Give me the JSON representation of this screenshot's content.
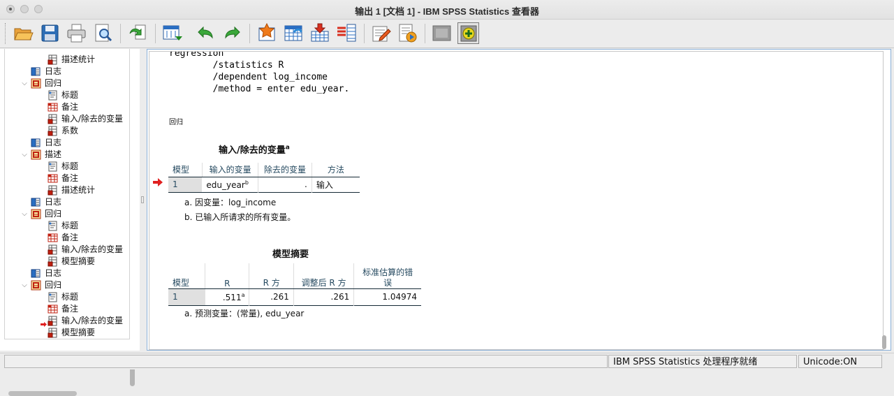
{
  "window": {
    "title": "输出 1 [文档 1] - IBM SPSS Statistics 查看器"
  },
  "toolbar": {
    "buttons": [
      {
        "name": "open-icon"
      },
      {
        "name": "save-icon"
      },
      {
        "name": "print-icon"
      },
      {
        "name": "print-preview-icon"
      },
      {
        "name": "export-icon"
      },
      {
        "name": "goto-data-icon"
      },
      {
        "name": "undo-icon"
      },
      {
        "name": "redo-icon"
      },
      {
        "name": "goto-case-icon"
      },
      {
        "name": "goto-variable-icon"
      },
      {
        "name": "insert-cases-icon"
      },
      {
        "name": "variables-icon"
      },
      {
        "name": "edit-icon"
      },
      {
        "name": "run-script-icon"
      },
      {
        "name": "hide-icon"
      },
      {
        "name": "designate-window-icon"
      }
    ]
  },
  "nav": {
    "items": [
      {
        "label": "描述统计",
        "level": 2,
        "icon": "table-icon"
      },
      {
        "label": "日志",
        "level": 1,
        "icon": "log-icon"
      },
      {
        "label": "回归",
        "level": 1,
        "icon": "procedure-icon",
        "expandable": true
      },
      {
        "label": "标题",
        "level": 2,
        "icon": "title-icon"
      },
      {
        "label": "备注",
        "level": 2,
        "icon": "notes-icon"
      },
      {
        "label": "输入/除去的变量",
        "level": 2,
        "icon": "table-icon"
      },
      {
        "label": "系数",
        "level": 2,
        "icon": "table-icon"
      },
      {
        "label": "日志",
        "level": 1,
        "icon": "log-icon"
      },
      {
        "label": "描述",
        "level": 1,
        "icon": "procedure-icon",
        "expandable": true
      },
      {
        "label": "标题",
        "level": 2,
        "icon": "title-icon"
      },
      {
        "label": "备注",
        "level": 2,
        "icon": "notes-icon"
      },
      {
        "label": "描述统计",
        "level": 2,
        "icon": "table-icon"
      },
      {
        "label": "日志",
        "level": 1,
        "icon": "log-icon"
      },
      {
        "label": "回归",
        "level": 1,
        "icon": "procedure-icon",
        "expandable": true
      },
      {
        "label": "标题",
        "level": 2,
        "icon": "title-icon"
      },
      {
        "label": "备注",
        "level": 2,
        "icon": "notes-icon"
      },
      {
        "label": "输入/除去的变量",
        "level": 2,
        "icon": "table-icon"
      },
      {
        "label": "模型摘要",
        "level": 2,
        "icon": "table-icon"
      },
      {
        "label": "日志",
        "level": 1,
        "icon": "log-icon"
      },
      {
        "label": "回归",
        "level": 1,
        "icon": "procedure-icon",
        "expandable": true
      },
      {
        "label": "标题",
        "level": 2,
        "icon": "title-icon"
      },
      {
        "label": "备注",
        "level": 2,
        "icon": "notes-icon"
      },
      {
        "label": "输入/除去的变量",
        "level": 2,
        "icon": "table-icon",
        "current": true
      },
      {
        "label": "模型摘要",
        "level": 2,
        "icon": "table-icon"
      }
    ]
  },
  "output": {
    "syntax": "regression\n        /statistics R\n        /dependent log_income\n        /method = enter edu_year.",
    "heading": "回归",
    "table1": {
      "title": "输入/除去的变量",
      "title_sup": "a",
      "headers": [
        "模型",
        "输入的变量",
        "除去的变量",
        "方法"
      ],
      "row": {
        "model": "1",
        "entered": "edu_year",
        "entered_sup": "b",
        "removed": ".",
        "method": "输入"
      },
      "notes": [
        "a. 因变量：log_income",
        "b. 已输入所请求的所有变量。"
      ]
    },
    "table2": {
      "title": "模型摘要",
      "headers": [
        "模型",
        "R",
        "R 方",
        "调整后 R 方",
        "标准估算的错误"
      ],
      "header_last_line1": "标准估算的错",
      "header_last_line2": "误",
      "row": {
        "model": "1",
        "r": ".511",
        "r_sup": "a",
        "r2": ".261",
        "adj_r2": ".261",
        "se": "1.04974"
      },
      "notes": [
        "a. 预测变量：(常量), edu_year"
      ]
    }
  },
  "status": {
    "processor": "IBM SPSS Statistics 处理程序就绪",
    "unicode": "Unicode:ON"
  },
  "colors": {
    "header_text": "#264a60",
    "arrow": "#e02020",
    "content_border": "#8ab0d8"
  }
}
